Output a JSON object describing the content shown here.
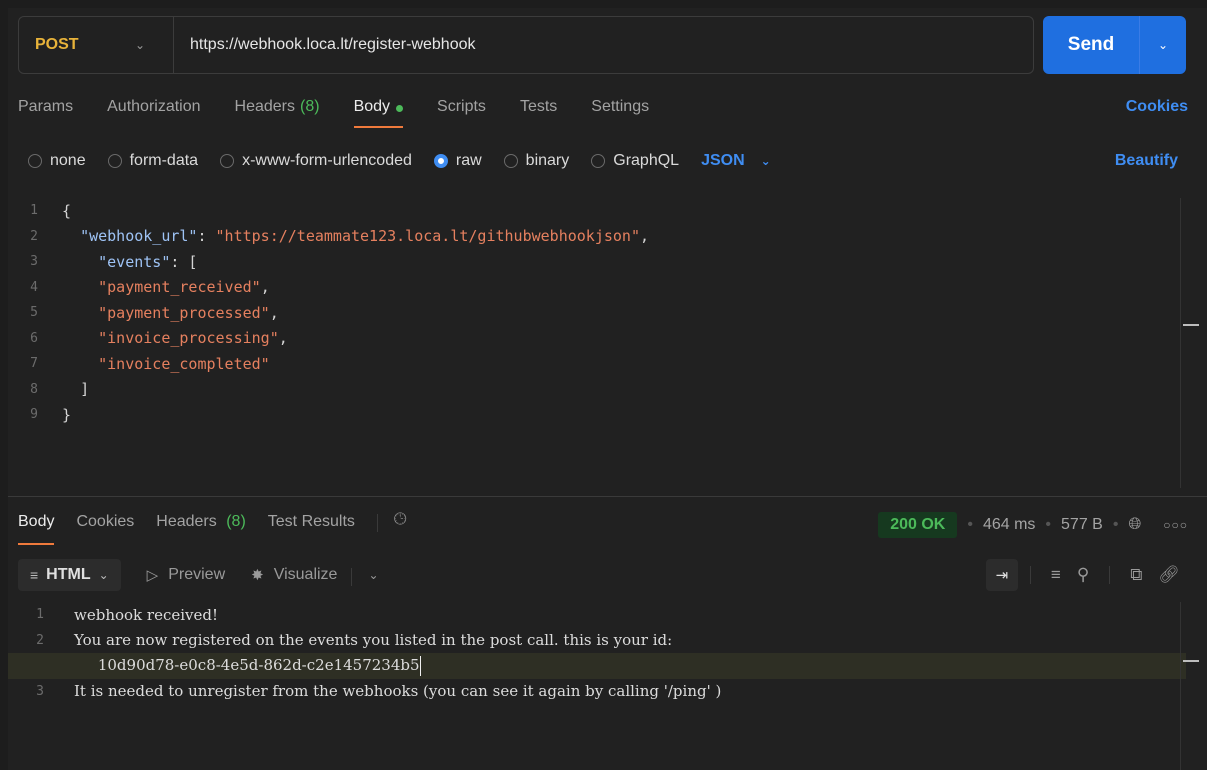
{
  "request": {
    "method": "POST",
    "url": "https://webhook.loca.lt/register-webhook",
    "send_label": "Send"
  },
  "req_tabs": {
    "params": "Params",
    "authorization": "Authorization",
    "headers": "Headers",
    "headers_count": "(8)",
    "body": "Body",
    "scripts": "Scripts",
    "tests": "Tests",
    "settings": "Settings",
    "cookies": "Cookies"
  },
  "body_types": {
    "none": "none",
    "form_data": "form-data",
    "urlencoded": "x-www-form-urlencoded",
    "raw": "raw",
    "binary": "binary",
    "graphql": "GraphQL",
    "format": "JSON",
    "beautify": "Beautify",
    "selected": "raw"
  },
  "code": {
    "line_numbers": [
      "1",
      "2",
      "3",
      "4",
      "5",
      "6",
      "7",
      "8",
      "9"
    ],
    "open_brace": "{",
    "key_webhook_url": "\"webhook_url\"",
    "val_webhook_url": "\"https://teammate123.loca.lt/githubwebhookjson\"",
    "key_events": "\"events\"",
    "ev1": "\"payment_received\"",
    "ev2": "\"payment_processed\"",
    "ev3": "\"invoice_processing\"",
    "ev4": "\"invoice_completed\"",
    "close_bracket": "]",
    "close_brace": "}"
  },
  "resp_tabs": {
    "body": "Body",
    "cookies": "Cookies",
    "headers": "Headers",
    "headers_count": "(8)",
    "test_results": "Test Results"
  },
  "status": {
    "code": "200 OK",
    "time": "464 ms",
    "size": "577 B"
  },
  "resp_toolbar": {
    "format": "HTML",
    "preview": "Preview",
    "visualize": "Visualize"
  },
  "response": {
    "line_numbers": [
      "1",
      "2",
      "3"
    ],
    "line1": "webhook received!",
    "line2": "You are now registered on the events you listed in the post call. this is your id:",
    "line2_cont": "10d90d78-e0c8-4e5d-862d-c2e1457234b5",
    "line3": "It is needed to unregister from the webhooks (you can see it again by calling '/ping' )"
  },
  "colors": {
    "accent": "#1f6fe0",
    "method": "#e8b33a",
    "tab_underline": "#f07a3c",
    "ok": "#4cba5a",
    "link": "#3f8df2"
  }
}
